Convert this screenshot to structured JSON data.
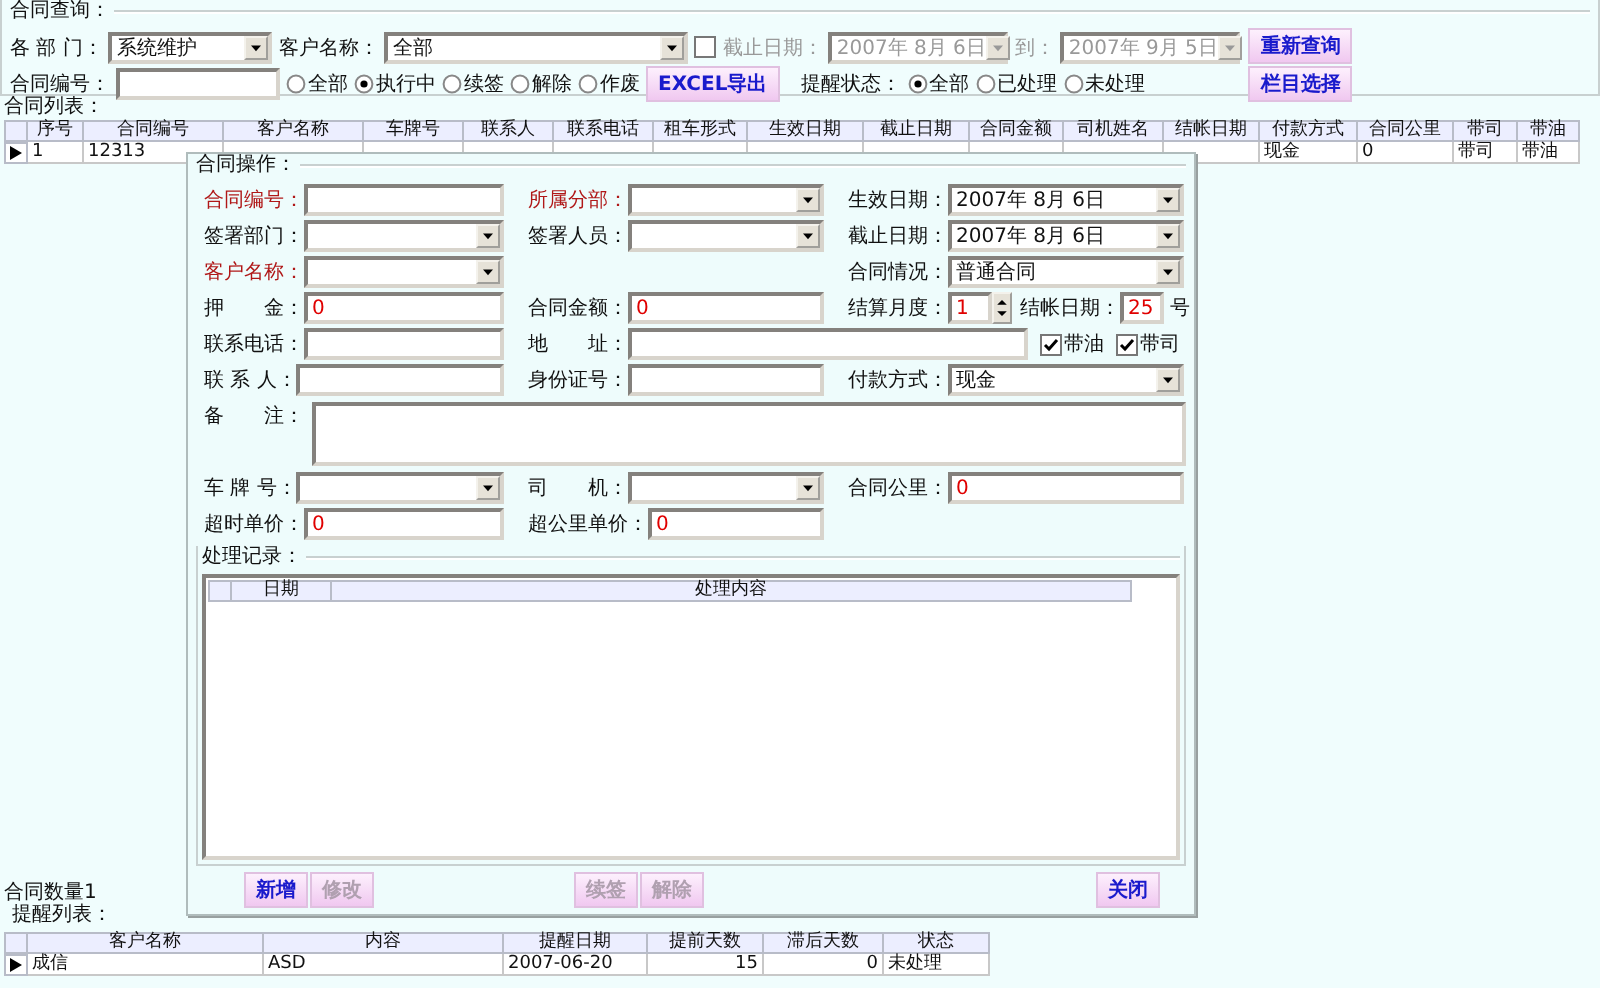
{
  "query": {
    "title": "合同查询：",
    "department": {
      "label": "各 部 门：",
      "value": "系统维护"
    },
    "customer": {
      "label": "客户名称：",
      "value": "全部"
    },
    "end_date": {
      "checked": false,
      "label": "截止日期：",
      "from": "2007年 8月 6日",
      "to_label": "到：",
      "to": "2007年 9月 5日"
    },
    "contract_no": {
      "label": "合同编号："
    },
    "status_options": [
      {
        "label": "全部",
        "selected": false
      },
      {
        "label": "执行中",
        "selected": true
      },
      {
        "label": "续签",
        "selected": false
      },
      {
        "label": "解除",
        "selected": false
      },
      {
        "label": "作废",
        "selected": false
      }
    ],
    "excel_button": "EXCEL导出",
    "reminder_label": "提醒状态：",
    "reminder_options": [
      {
        "label": "全部",
        "selected": true
      },
      {
        "label": "已处理",
        "selected": false
      },
      {
        "label": "未处理",
        "selected": false
      }
    ],
    "buttons": [
      "重新查询",
      "栏目选择"
    ]
  },
  "contract_list": {
    "title": "合同列表：",
    "columns": [
      "序号",
      "合同编号",
      "客户名称",
      "车牌号",
      "联系人",
      "联系电话",
      "租车形式",
      "生效日期",
      "截止日期",
      "合同金额",
      "司机姓名",
      "结帐日期",
      "付款方式",
      "合同公里",
      "带司",
      "带油"
    ],
    "rows": [
      {
        "selected": true,
        "cells": [
          "1",
          "12313",
          null,
          null,
          null,
          null,
          null,
          null,
          null,
          null,
          null,
          null,
          "现金",
          "0",
          "带司",
          "带油"
        ]
      }
    ]
  },
  "count_label": "合同数量1",
  "reminder_list": {
    "title": "提醒列表：",
    "columns": [
      "客户名称",
      "内容",
      "提醒日期",
      "提前天数",
      "滞后天数",
      "状态"
    ],
    "rows": [
      {
        "selected": true,
        "cells": [
          "成信",
          "ASD",
          "2007-06-20",
          "15",
          "0",
          "未处理"
        ]
      }
    ]
  },
  "dialog": {
    "title": "合同操作：",
    "rows": [
      {
        "left": {
          "kind": "text",
          "label": "合同编号：",
          "required": true
        },
        "middle": {
          "kind": "select",
          "label": "所属分部：",
          "required": true
        },
        "right": {
          "kind": "select",
          "label": "生效日期：",
          "value": "2007年 8月 6日",
          "required": false
        }
      },
      {
        "left": {
          "kind": "select",
          "label": "签署部门：",
          "required": false
        },
        "middle": {
          "kind": "select",
          "label": "签署人员：",
          "required": false
        },
        "right": {
          "kind": "select",
          "label": "截止日期：",
          "value": "2007年 8月 6日",
          "required": false
        }
      },
      {
        "left": {
          "kind": "select",
          "label": "客户名称：",
          "required": true
        },
        "right": {
          "kind": "select",
          "label": "合同情况：",
          "value": "普通合同",
          "required": false
        }
      },
      {
        "left": {
          "kind": "text",
          "label": "押　　金：",
          "value": "0",
          "required": false
        },
        "middle": {
          "kind": "text",
          "label": "合同金额：",
          "value": "0",
          "required": false
        },
        "right": {
          "kind": "settlement",
          "label": "结算月度：",
          "value": "1",
          "day_label": "结帐日期：",
          "day": "25",
          "unit": "号"
        }
      },
      {
        "left": {
          "kind": "text",
          "label": "联系电话：",
          "required": false
        },
        "middle": {
          "kind": "address",
          "label": "地　　址：",
          "required": false
        },
        "right": {
          "kind": "checks",
          "items": [
            {
              "label": "带油",
              "checked": true
            },
            {
              "label": "带司",
              "checked": true
            }
          ]
        }
      },
      {
        "left": {
          "kind": "text",
          "label": "联 系 人：",
          "required": false
        },
        "middle": {
          "kind": "text",
          "label": "身份证号：",
          "required": false
        },
        "right": {
          "kind": "select",
          "label": "付款方式：",
          "value": "现金",
          "required": false
        }
      },
      {
        "full": {
          "kind": "textarea",
          "label": "备　　注："
        }
      },
      {
        "left": {
          "kind": "select",
          "label": "车 牌 号：",
          "required": false
        },
        "middle": {
          "kind": "select",
          "label": "司　　机：",
          "required": false
        },
        "right": {
          "kind": "text",
          "label": "合同公里：",
          "value": "0",
          "required": false
        }
      },
      {
        "left": {
          "kind": "text",
          "label": "超时单价：",
          "value": "0",
          "required": false
        },
        "middle": {
          "kind": "text",
          "label": "超公里单价：",
          "value": "0",
          "required": false
        }
      }
    ],
    "records": {
      "title": "处理记录：",
      "columns": [
        "日期",
        "处理内容"
      ]
    },
    "button_groups": [
      [
        {
          "label": "新增",
          "disabled": false
        },
        {
          "label": "修改",
          "disabled": true
        }
      ],
      [
        {
          "label": "续签",
          "disabled": true
        },
        {
          "label": "解除",
          "disabled": true
        }
      ],
      [
        {
          "label": "关闭",
          "disabled": false
        }
      ]
    ]
  }
}
